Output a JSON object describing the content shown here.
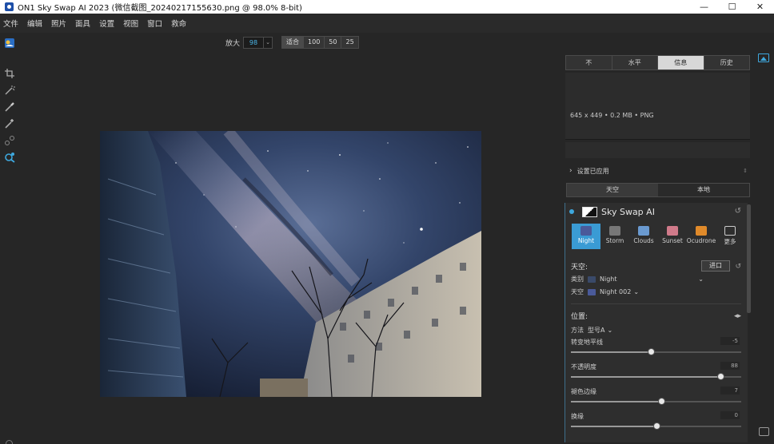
{
  "window": {
    "title": "ON1 Sky Swap AI 2023 (微信截图_20240217155630.png @ 98.0% 8-bit)",
    "minimize": "—",
    "maximize": "☐",
    "close": "✕"
  },
  "menu": [
    "文件",
    "编辑",
    "照片",
    "面具",
    "设置",
    "视图",
    "窗口",
    "救命"
  ],
  "zoom": {
    "label": "放大",
    "value": "98",
    "presets": [
      "适合",
      "100",
      "50",
      "25"
    ]
  },
  "left_tools": [
    "crop-icon",
    "magic-wand-icon",
    "brush-icon",
    "refine-brush-icon",
    "chain-icon",
    "zoom-icon"
  ],
  "panel": {
    "tabs": [
      "不",
      "水平",
      "信息",
      "历史"
    ],
    "active_tab": 2,
    "info": "645 x 449 • 0.2 MB • PNG",
    "settings_applied": "设置已应用",
    "source_tabs": [
      "天空",
      "本地"
    ]
  },
  "module": {
    "title": "Sky Swap AI",
    "presets": [
      {
        "label": "Night",
        "color": "#4a5a9a"
      },
      {
        "label": "Storm",
        "color": "#777777"
      },
      {
        "label": "Clouds",
        "color": "#6a9ad0"
      },
      {
        "label": "Sunset",
        "color": "#d07a8a"
      },
      {
        "label": "Ocudrone",
        "color": "#e08a2a"
      },
      {
        "label": "更多",
        "color": "#cccccc"
      }
    ],
    "sky_section": "天空:",
    "import_label": "进口",
    "category_label": "类别",
    "category_value": "Night",
    "sky_label": "天空",
    "sky_value": "Night 002",
    "position_section": "位置:",
    "method_label": "方法",
    "method_value": "型号A",
    "sliders": [
      {
        "label": "转变地平线",
        "value": "-5",
        "fraction": 0.47
      },
      {
        "label": "不透明度",
        "value": "88",
        "fraction": 0.88
      },
      {
        "label": "褪色边缘",
        "value": "7",
        "fraction": 0.53
      },
      {
        "label": "换缘",
        "value": "0",
        "fraction": 0.5
      }
    ]
  },
  "colors": {
    "accent": "#3ea8de",
    "active_preset": "#3a9bd4",
    "background": "#262626"
  }
}
